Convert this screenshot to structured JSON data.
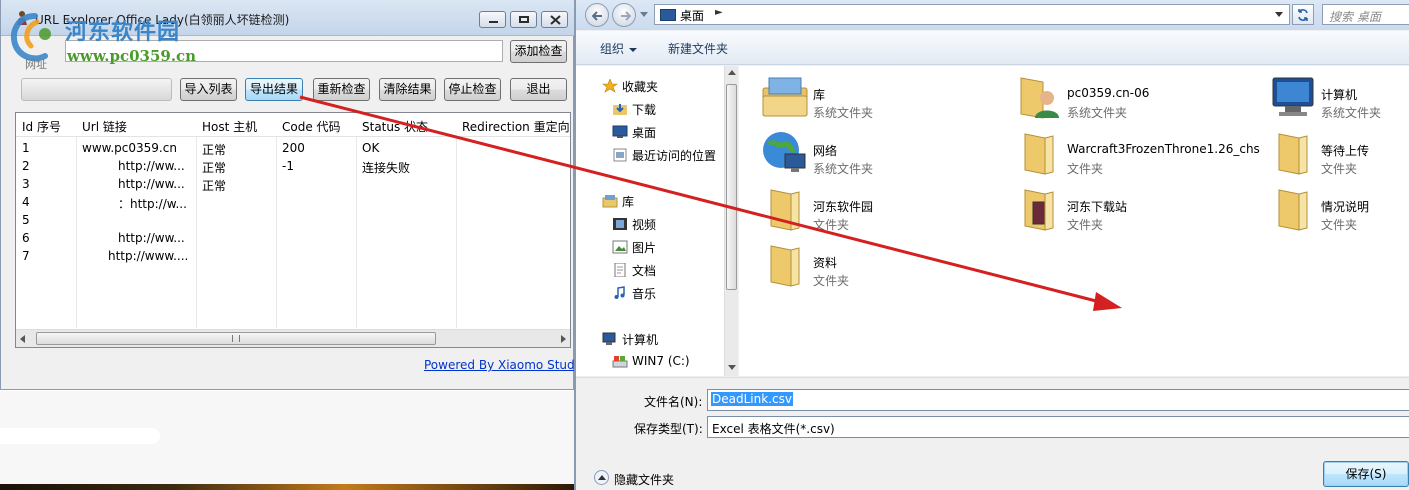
{
  "url_explorer": {
    "title": "URL Explorer Office Lady(白领丽人坏链检测)",
    "watermark_cn": "河东软件园",
    "watermark_url": "www.pc0359.cn",
    "url_label": "网址",
    "add_check_label": "添加检查",
    "buttons": {
      "import_list": "导入列表",
      "export_results": "导出结果",
      "recheck": "重新检查",
      "clear_results": "清除结果",
      "stop_check": "停止检查",
      "exit": "退出"
    },
    "columns": [
      "Id 序号",
      "Url 链接",
      "Host 主机",
      "Code 代码",
      "Status 状态",
      "Redirection 重定向"
    ],
    "rows": [
      {
        "id": "1",
        "url": "www.pc0359.cn",
        "host": "正常",
        "code": "200",
        "status": "OK"
      },
      {
        "id": "2",
        "url": "http://ww...",
        "host": "正常",
        "code": "-1",
        "status": "连接失败"
      },
      {
        "id": "3",
        "url": "http://ww...",
        "host": "正常",
        "code": "",
        "status": ""
      },
      {
        "id": "4",
        "url": "：http://w...",
        "host": "",
        "code": "",
        "status": ""
      },
      {
        "id": "5",
        "url": "",
        "host": "",
        "code": "",
        "status": ""
      },
      {
        "id": "6",
        "url": "http://ww...",
        "host": "",
        "code": "",
        "status": ""
      },
      {
        "id": "7",
        "url": "http://www....",
        "host": "",
        "code": "",
        "status": ""
      }
    ],
    "powered_by": "Powered By Xiaomo Studio"
  },
  "save_dialog": {
    "address": "桌面",
    "search_placeholder": "搜索 桌面",
    "toolbar": {
      "organize": "组织",
      "new_folder": "新建文件夹"
    },
    "nav": {
      "favorites": "收藏夹",
      "downloads": "下载",
      "desktop": "桌面",
      "recent": "最近访问的位置",
      "libraries": "库",
      "videos": "视频",
      "pictures": "图片",
      "documents": "文档",
      "music": "音乐",
      "computer": "计算机",
      "drive_c": "WIN7 (C:)"
    },
    "files": [
      {
        "name": "库",
        "type": "系统文件夹",
        "icon": "library-icon"
      },
      {
        "name": "pc0359.cn-06",
        "type": "系统文件夹",
        "icon": "user-folder-icon"
      },
      {
        "name": "计算机",
        "type": "系统文件夹",
        "icon": "computer-icon"
      },
      {
        "name": "网络",
        "type": "系统文件夹",
        "icon": "network-icon"
      },
      {
        "name": "Warcraft3FrozenThrone1.26_chs",
        "type": "文件夹",
        "icon": "folder-icon"
      },
      {
        "name": "等待上传",
        "type": "文件夹",
        "icon": "folder-icon"
      },
      {
        "name": "河东软件园",
        "type": "文件夹",
        "icon": "folder-icon"
      },
      {
        "name": "河东下载站",
        "type": "文件夹",
        "icon": "folder-icon"
      },
      {
        "name": "情况说明",
        "type": "文件夹",
        "icon": "folder-icon"
      },
      {
        "name": "资料",
        "type": "文件夹",
        "icon": "folder-icon"
      }
    ],
    "filename_label": "文件名(N):",
    "filename_value": "DeadLink.csv",
    "filetype_label": "保存类型(T):",
    "filetype_value": "Excel 表格文件(*.csv)",
    "hide_folders": "隐藏文件夹",
    "save_button": "保存(S)"
  },
  "colors": {
    "annotation_arrow": "#d42020",
    "watermark_blue": "#3b86c9",
    "watermark_green": "#4b9a2c",
    "selection": "#3399ff",
    "link": "#0033cc"
  }
}
